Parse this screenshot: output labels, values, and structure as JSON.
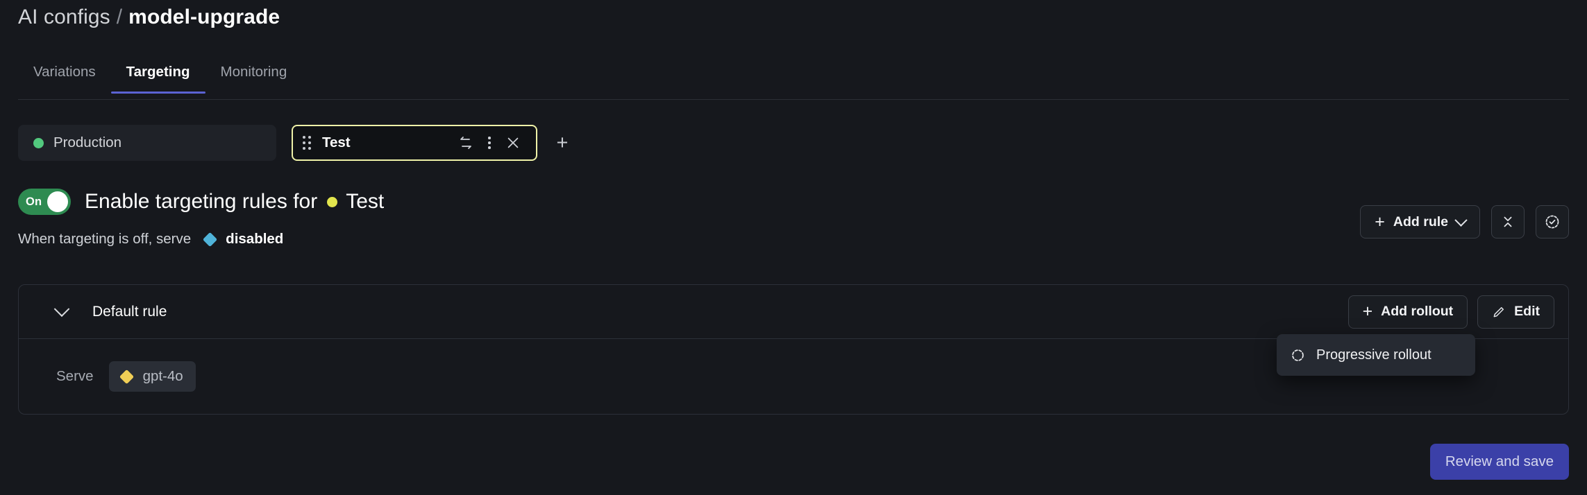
{
  "breadcrumb": {
    "parent": "AI configs",
    "separator": "/",
    "current": "model-upgrade"
  },
  "tabs": [
    {
      "label": "Variations",
      "active": false
    },
    {
      "label": "Targeting",
      "active": true
    },
    {
      "label": "Monitoring",
      "active": false
    }
  ],
  "environments": {
    "production": {
      "label": "Production",
      "dot_color": "#52C97E"
    },
    "selected": {
      "label": "Test",
      "dot_color": "#E2E54D",
      "border_color": "#EFF2A8"
    },
    "add_label": "+"
  },
  "targeting": {
    "toggle": {
      "state_label": "On",
      "on": true,
      "color": "#2E8B51"
    },
    "title_prefix": "Enable targeting rules for",
    "environment_name": "Test",
    "off_text": "When targeting is off, serve",
    "off_variation": "disabled",
    "off_variation_color": "#4FB3D9",
    "add_rule_label": "Add rule"
  },
  "rule": {
    "title": "Default rule",
    "add_rollout_label": "Add rollout",
    "edit_label": "Edit",
    "serve_label": "Serve",
    "serve_variation": "gpt-4o",
    "serve_variation_color": "#F0CE56"
  },
  "dropdown": {
    "items": [
      {
        "label": "Progressive rollout",
        "icon": "progress-circle-icon"
      }
    ]
  },
  "footer": {
    "primary_label": "Review and save",
    "primary_color": "#3B40A8"
  },
  "icons": {
    "drag": "drag-handle-icon",
    "swap": "swap-arrows-icon",
    "kebab": "kebab-menu-icon",
    "close": "close-icon",
    "add": "plus-icon",
    "collapse_all": "collapse-all-icon",
    "validate": "validate-check-icon",
    "edit": "pencil-icon",
    "chevron_down": "chevron-down-icon"
  }
}
